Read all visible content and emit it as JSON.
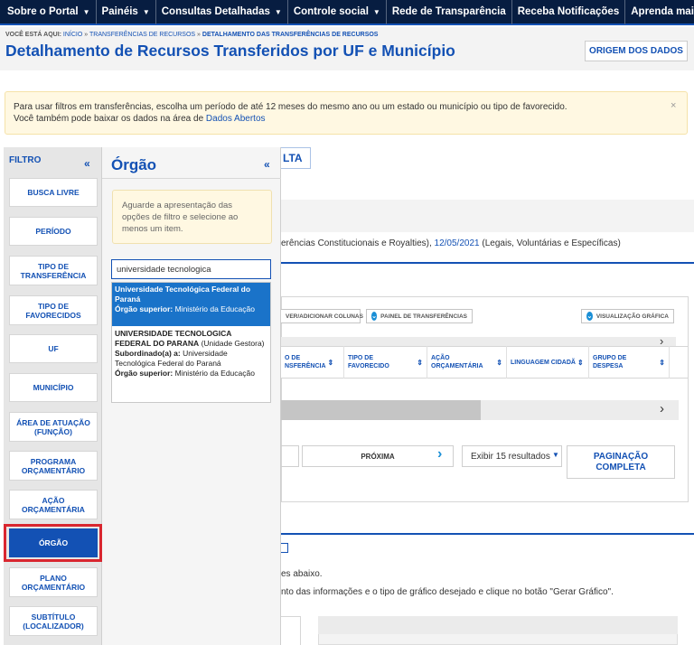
{
  "nav": {
    "items": [
      {
        "label": "Sobre o Portal",
        "caret": "▼"
      },
      {
        "label": "Painéis",
        "caret": "▼"
      },
      {
        "label": "Consultas Detalhadas",
        "caret": "▼"
      },
      {
        "label": "Controle social",
        "caret": "▼"
      },
      {
        "label": "Rede de Transparência",
        "caret": ""
      },
      {
        "label": "Receba Notificações",
        "caret": ""
      },
      {
        "label": "Aprenda mais",
        "caret": "▼"
      }
    ]
  },
  "breadcrumb": {
    "prefix": "Você está aqui:",
    "home": "Início",
    "sep": "»",
    "section": "Transferências de Recursos",
    "current": "Detalhamento das Transferências de Recursos"
  },
  "page": {
    "title": "Detalhamento de Recursos Transferidos por UF e Município",
    "origem_button": "ORIGEM DOS DADOS"
  },
  "alert": {
    "line1": "Para usar filtros em transferências, escolha um período de até 12 meses do mesmo ano ou um estado ou município ou tipo de favorecido.",
    "line2_prefix": "Você também pode baixar os dados na área de ",
    "line2_link": "Dados Abertos",
    "close": "×"
  },
  "filter": {
    "title": "FILTRO",
    "collapse": "«",
    "buttons": [
      {
        "label": "Busca Livre",
        "active": false
      },
      {
        "label": "Período",
        "active": false
      },
      {
        "label": "Tipo de Transferência",
        "active": false
      },
      {
        "label": "Tipo de Favorecidos",
        "active": false
      },
      {
        "label": "UF",
        "active": false
      },
      {
        "label": "Município",
        "active": false
      },
      {
        "label": "Área de Atuação (Função)",
        "active": false
      },
      {
        "label": "Programa Orçamentário",
        "active": false
      },
      {
        "label": "Ação Orçamentária",
        "active": false
      },
      {
        "label": "Órgão",
        "active": true
      },
      {
        "label": "Plano Orçamentário",
        "active": false
      },
      {
        "label": "Subtítulo (Localizador)",
        "active": false
      }
    ]
  },
  "orgao": {
    "title": "Órgão",
    "collapse": "«",
    "hint": "Aguarde a apresentação das opções de filtro e selecione ao menos um item.",
    "search_value": "universidade tecnologica",
    "suggestions": [
      {
        "name": "Universidade Tecnológica Federal do Paraná",
        "superior_label": "Órgão superior:",
        "superior": "Ministério da Educação"
      },
      {
        "name": "UNIVERSIDADE TECNOLOGICA FEDERAL DO PARANA",
        "type": "(Unidade Gestora)",
        "sub_label": "Subordinado(a) a:",
        "sub": "Universidade Tecnológica Federal do Paraná",
        "superior_label": "Órgão superior:",
        "superior": "Ministério da Educação"
      }
    ]
  },
  "content": {
    "consulta_tab": "LTA",
    "dates_prefix": "erências Constitucionais e Royalties), ",
    "dates_link": "12/05/2021",
    "dates_suffix": " (Legais, Voluntárias e Específicas)",
    "toolbar": {
      "columns": "Ver/Adicionar Colunas",
      "painel": "Painel de Transferências",
      "grafico": "Visualização Gráfica"
    },
    "columns": [
      {
        "label": "o de\nnsferência"
      },
      {
        "label": "Tipo de Favorecido"
      },
      {
        "label": "Ação Orçamentária"
      },
      {
        "label": "Linguagem Cidadã"
      },
      {
        "label": "Grupo de Despesa"
      }
    ],
    "next": "PRÓXIMA",
    "page_size": "Exibir 15 resultados",
    "pag_completa": "PAGINAÇÃO COMPLETA",
    "chart_text_1": "es abaixo.",
    "chart_text_2": "nto das informações e o tipo de gráfico desejado e clique no botão \"Gerar Gráfico\"."
  }
}
